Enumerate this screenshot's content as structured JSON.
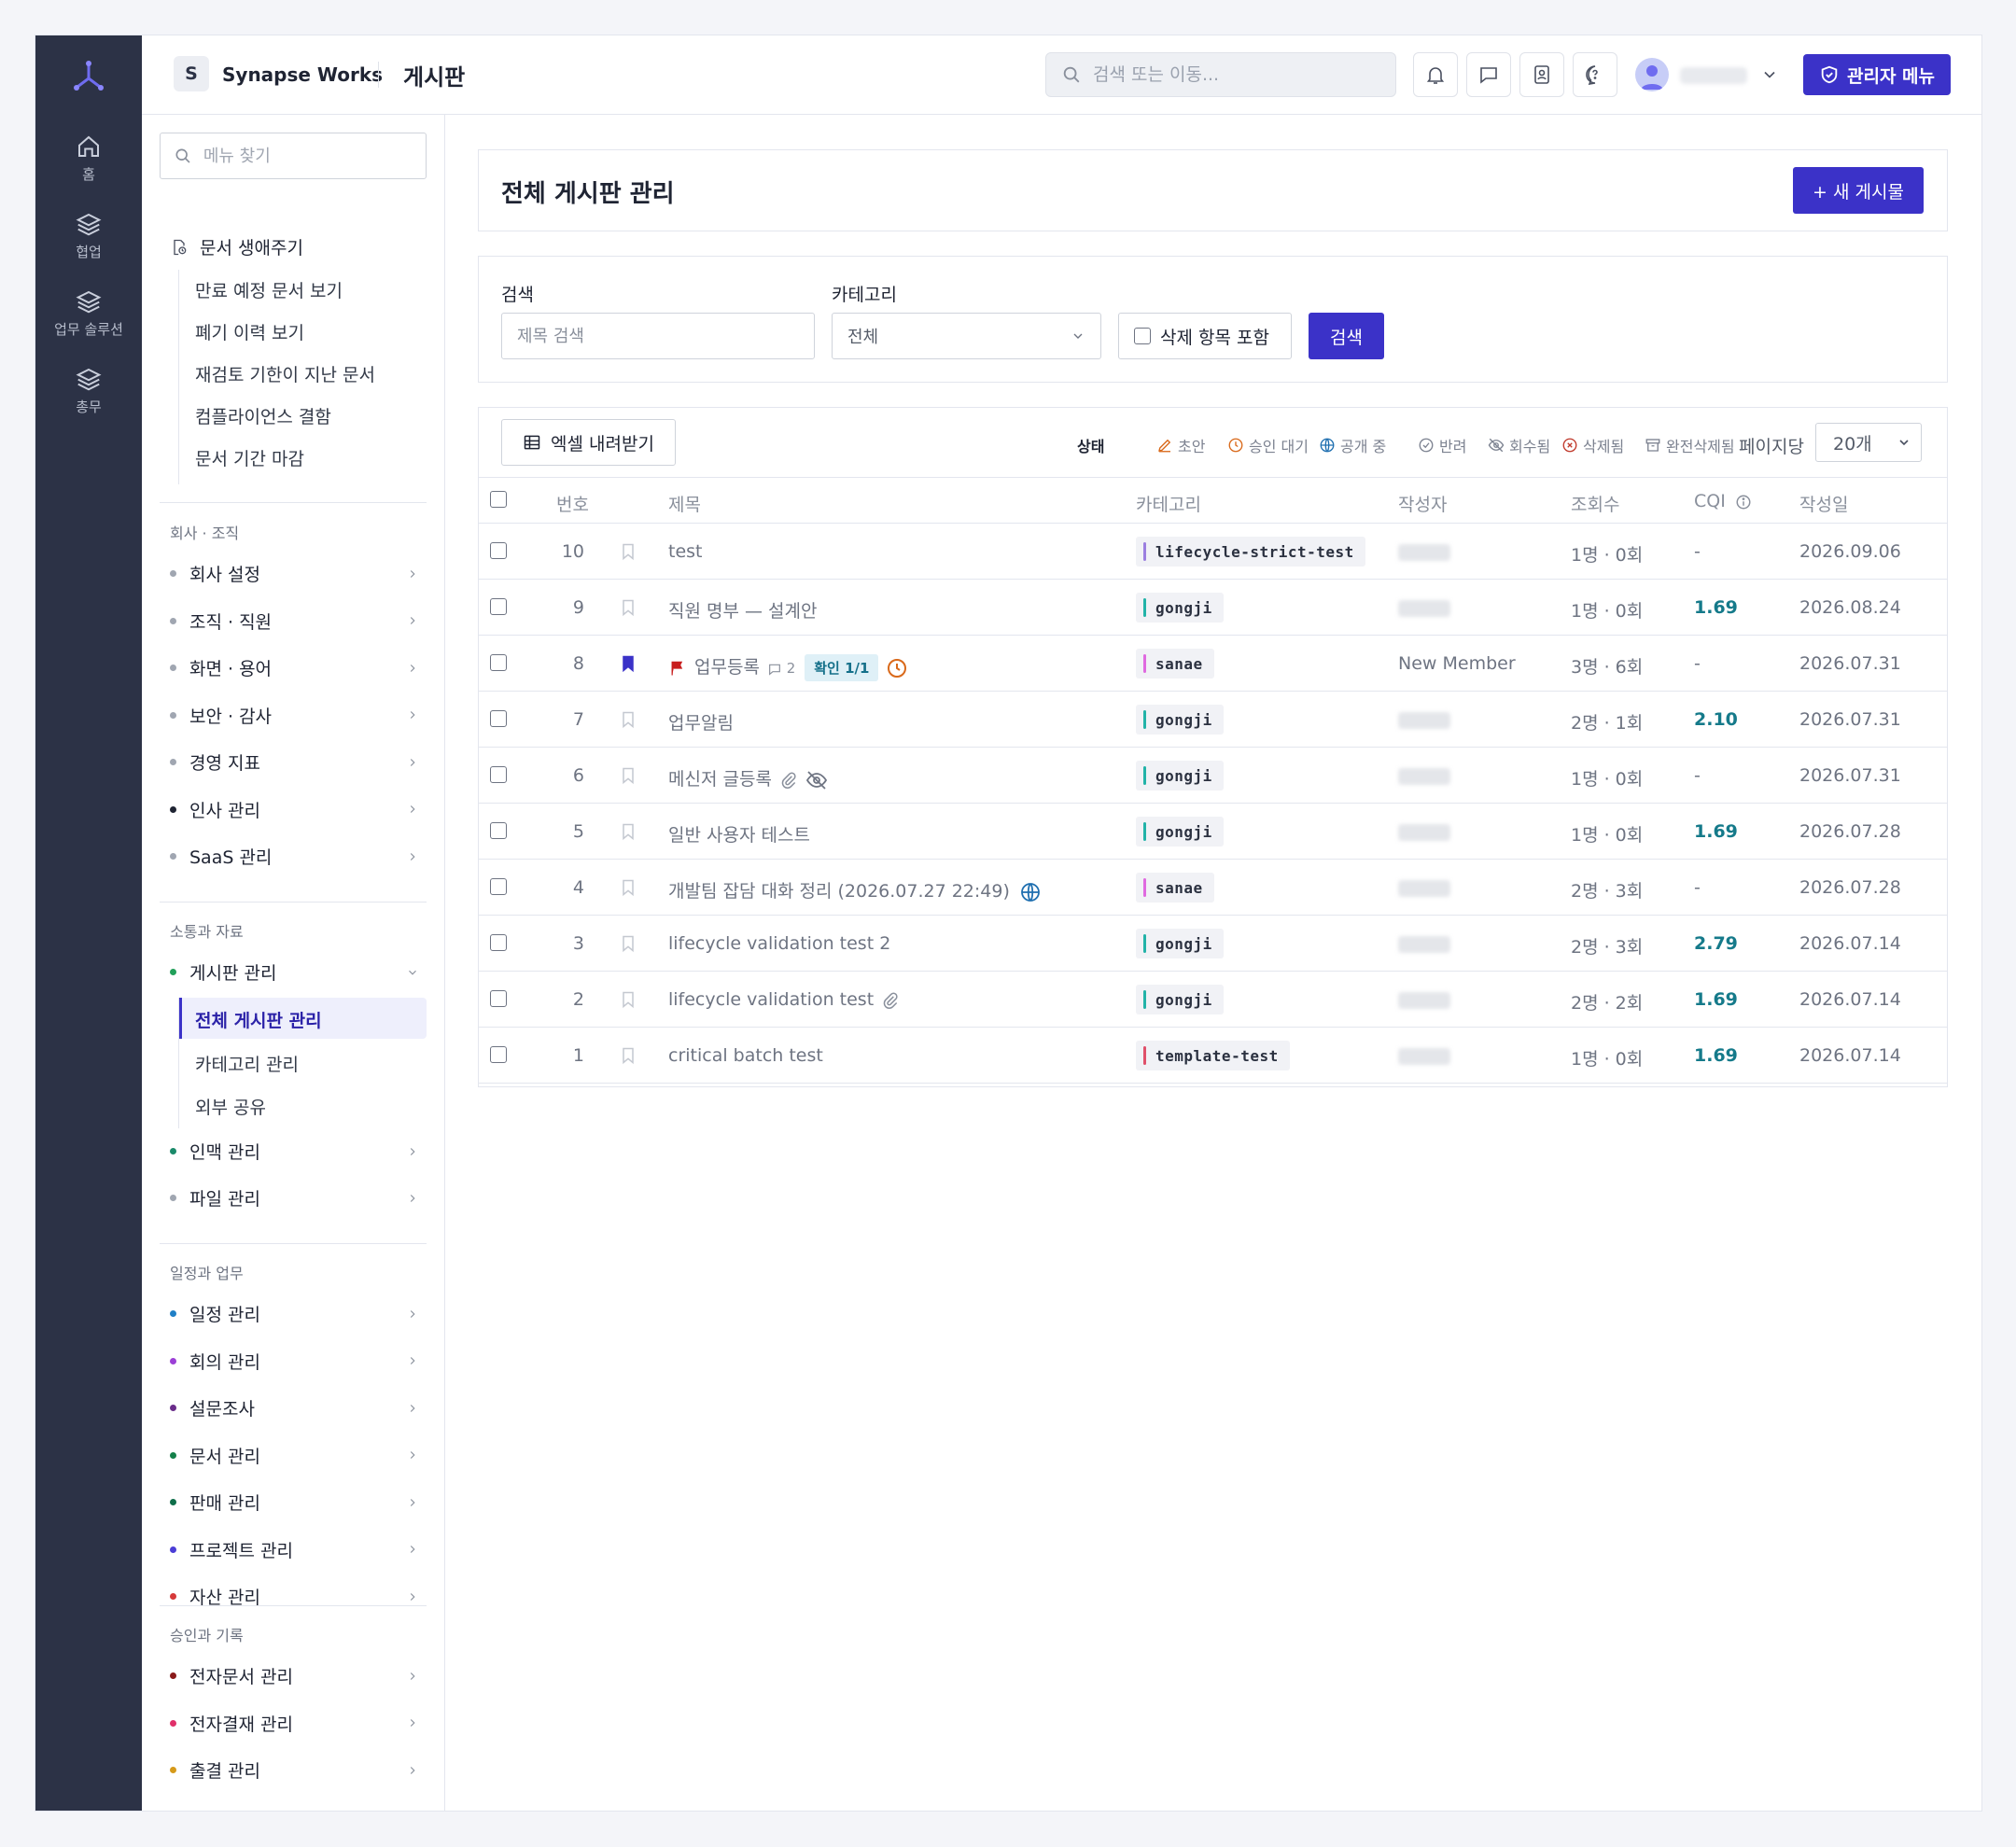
{
  "rail": {
    "items": [
      {
        "label": "홈",
        "icon": "home-icon"
      },
      {
        "label": "협업",
        "icon": "layers-icon"
      },
      {
        "label": "업무 솔루션",
        "icon": "layers-icon"
      },
      {
        "label": "총무",
        "icon": "layers-icon"
      }
    ]
  },
  "header": {
    "workspace_initial": "S",
    "workspace_name": "Synapse Works",
    "page": "게시판",
    "search_placeholder": "검색 또는 이동...",
    "admin_label": "관리자 메뉴"
  },
  "sidebar": {
    "search_placeholder": "메뉴 찾기",
    "lifecycle": {
      "title": "문서 생애주기",
      "items": [
        "만료 예정 문서 보기",
        "폐기 이력 보기",
        "재검토 기한이 지난 문서",
        "컴플라이언스 결함",
        "문서 기간 마감"
      ]
    },
    "groups": [
      {
        "title": "회사 · 조직",
        "items": [
          {
            "label": "회사 설정",
            "color": "#a0a6b1"
          },
          {
            "label": "조직 · 직원",
            "color": "#a0a6b1"
          },
          {
            "label": "화면 · 용어",
            "color": "#a0a6b1"
          },
          {
            "label": "보안 · 감사",
            "color": "#a0a6b1"
          },
          {
            "label": "경영 지표",
            "color": "#a0a6b1"
          },
          {
            "label": "인사 관리",
            "color": "#1f2433"
          },
          {
            "label": "SaaS 관리",
            "color": "#a0a6b1"
          }
        ]
      },
      {
        "title": "소통과 자료",
        "items": [
          {
            "label": "게시판 관리",
            "color": "#22a05a"
          },
          {
            "label": "인맥 관리",
            "color": "#1a8a6a"
          },
          {
            "label": "파일 관리",
            "color": "#a0a6b1"
          }
        ]
      },
      {
        "title": "일정과 업무",
        "items": [
          {
            "label": "일정 관리",
            "color": "#1f7fc6"
          },
          {
            "label": "회의 관리",
            "color": "#9b3fd6"
          },
          {
            "label": "설문조사",
            "color": "#6a2d8a"
          },
          {
            "label": "문서 관리",
            "color": "#14804a"
          },
          {
            "label": "판매 관리",
            "color": "#0f6e4a"
          },
          {
            "label": "프로젝트 관리",
            "color": "#4b3ed6"
          },
          {
            "label": "자산 관리",
            "color": "#d63a3a"
          }
        ]
      },
      {
        "title": "승인과 기록",
        "items": [
          {
            "label": "전자문서 관리",
            "color": "#8a1a1a"
          },
          {
            "label": "전자결재 관리",
            "color": "#e0306a"
          },
          {
            "label": "출결 관리",
            "color": "#d69a1a"
          }
        ]
      }
    ],
    "board_subs": [
      "전체 게시판 관리",
      "카테고리 관리",
      "외부 공유"
    ]
  },
  "main": {
    "title": "전체 게시판 관리",
    "new_post": "+ 새 게시물",
    "filter": {
      "search_label": "검색",
      "search_placeholder": "제목 검색",
      "category_label": "카테고리",
      "category_value": "전체",
      "include_deleted": "삭제 항목 포함",
      "search_button": "검색"
    },
    "toolbar": {
      "excel": "엑셀 내려받기",
      "status_label": "상태",
      "statuses": [
        {
          "label": "초안",
          "icon": "pencil-icon",
          "color": "#d9691a"
        },
        {
          "label": "승인 대기",
          "icon": "clock-icon",
          "color": "#d9691a"
        },
        {
          "label": "공개 중",
          "icon": "globe-icon",
          "color": "#1f6fb0"
        },
        {
          "label": "반려",
          "icon": "check-circle-icon",
          "color": "#7c8290"
        },
        {
          "label": "회수됨",
          "icon": "eye-off-icon",
          "color": "#7c8290"
        },
        {
          "label": "삭제됨",
          "icon": "x-circle-icon",
          "color": "#c0392b"
        },
        {
          "label": "완전삭제됨",
          "icon": "archive-icon",
          "color": "#7c8290"
        }
      ],
      "per_page_label": "페이지당",
      "per_page_value": "20개"
    },
    "columns": [
      "번호",
      "제목",
      "카테고리",
      "작성자",
      "조회수",
      "CQI",
      "작성일"
    ],
    "rows": [
      {
        "no": "10",
        "title": "test",
        "category": "lifecycle-strict-test",
        "cat_color": "#9b7fe0",
        "author": "",
        "views": "1명 · 0회",
        "cqi": "-",
        "date": "2026.09.06"
      },
      {
        "no": "9",
        "title": "직원 명부 — 설계안",
        "category": "gongji",
        "cat_color": "#22b3a8",
        "author": "",
        "views": "1명 · 0회",
        "cqi": "1.69",
        "date": "2026.08.24"
      },
      {
        "no": "8",
        "title": "업무등록",
        "comments": "2",
        "confirm": "확인 1/1",
        "category": "sanae",
        "cat_color": "#e06ae0",
        "author": "New Member",
        "views": "3명 · 6회",
        "cqi": "-",
        "date": "2026.07.31"
      },
      {
        "no": "7",
        "title": "업무알림",
        "category": "gongji",
        "cat_color": "#22b3a8",
        "author": "",
        "views": "2명 · 1회",
        "cqi": "2.10",
        "date": "2026.07.31"
      },
      {
        "no": "6",
        "title": "메신저 글등록",
        "category": "gongji",
        "cat_color": "#22b3a8",
        "author": "",
        "views": "1명 · 0회",
        "cqi": "-",
        "date": "2026.07.31"
      },
      {
        "no": "5",
        "title": "일반 사용자 테스트",
        "category": "gongji",
        "cat_color": "#22b3a8",
        "author": "",
        "views": "1명 · 0회",
        "cqi": "1.69",
        "date": "2026.07.28"
      },
      {
        "no": "4",
        "title": "개발팀 잡담 대화 정리 (2026.07.27 22:49)",
        "category": "sanae",
        "cat_color": "#e06ae0",
        "author": "",
        "views": "2명 · 3회",
        "cqi": "-",
        "date": "2026.07.28"
      },
      {
        "no": "3",
        "title": "lifecycle validation test 2",
        "category": "gongji",
        "cat_color": "#22b3a8",
        "author": "",
        "views": "2명 · 3회",
        "cqi": "2.79",
        "date": "2026.07.14"
      },
      {
        "no": "2",
        "title": "lifecycle validation test",
        "category": "gongji",
        "cat_color": "#22b3a8",
        "author": "",
        "views": "2명 · 2회",
        "cqi": "1.69",
        "date": "2026.07.14"
      },
      {
        "no": "1",
        "title": "critical batch test",
        "category": "template-test",
        "cat_color": "#e0506a",
        "author": "",
        "views": "1명 · 0회",
        "cqi": "1.69",
        "date": "2026.07.14"
      }
    ]
  },
  "colors": {
    "accent": "#3b32c8",
    "rail": "#2c3246",
    "cqi": "#157a8a"
  }
}
